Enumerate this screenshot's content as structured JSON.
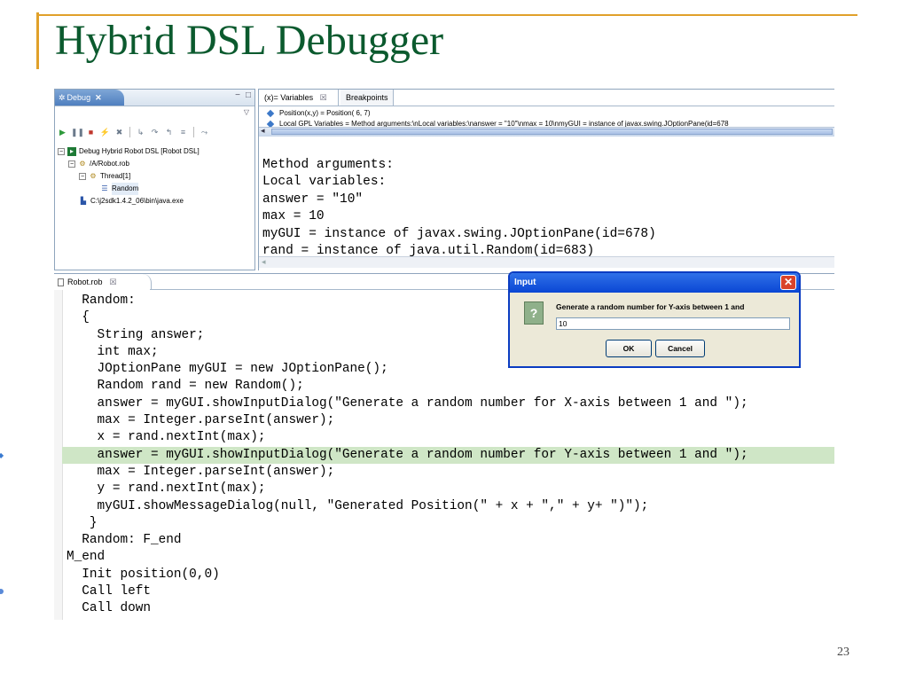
{
  "slide": {
    "title": "Hybrid DSL Debugger",
    "page_number": "23"
  },
  "debug_view": {
    "tab_label": "Debug",
    "tab_close": "✕",
    "minimize": "−",
    "maximize": "□",
    "view_menu": "▽",
    "tree": [
      {
        "label": "Debug Hybrid Robot DSL [Robot DSL]"
      },
      {
        "label": "/A/Robot.rob"
      },
      {
        "label": "Thread[1]"
      },
      {
        "label": "Random"
      },
      {
        "label": "C:\\j2sdk1.4.2_06\\bin\\java.exe"
      }
    ]
  },
  "variables_view": {
    "tab_variables": "(x)= Variables",
    "tab_close": "☒",
    "tab_breakpoints": "Breakpoints",
    "rows": [
      "Position(x,y) = Position( 6, 7)",
      "Local GPL Variables = Method arguments:\\nLocal variables:\\nanswer = \"10\"\\nmax = 10\\nmyGUI = instance of javax.swing.JOptionPane(id=678"
    ],
    "detail_lines": [
      "Method arguments:",
      "Local variables:",
      "answer = \"10\"",
      "max = 10",
      "myGUI = instance of javax.swing.JOptionPane(id=678)",
      "rand = instance of java.util.Random(id=683)"
    ]
  },
  "editor": {
    "tab_label": "Robot.rob",
    "tab_close": "☒",
    "highlight_line": 9,
    "lines": [
      "  Random:",
      "  {",
      "    String answer;",
      "    int max;",
      "    JOptionPane myGUI = new JOptionPane();",
      "    Random rand = new Random();",
      "    answer = myGUI.showInputDialog(\"Generate a random number for X-axis between 1 and \");",
      "    max = Integer.parseInt(answer);",
      "    x = rand.nextInt(max);",
      "    answer = myGUI.showInputDialog(\"Generate a random number for Y-axis between 1 and \");",
      "    max = Integer.parseInt(answer);",
      "    y = rand.nextInt(max);",
      "    myGUI.showMessageDialog(null, \"Generated Position(\" + x + \",\" + y+ \")\");",
      "   }",
      "  Random: F_end",
      "M_end",
      "  Init position(0,0)",
      "  Call left",
      "  Call down"
    ]
  },
  "dialog": {
    "title": "Input",
    "close": "✕",
    "icon": "?",
    "prompt": "Generate a random number for Y-axis between 1 and",
    "value": "10",
    "ok_label": "OK",
    "cancel_label": "Cancel"
  }
}
